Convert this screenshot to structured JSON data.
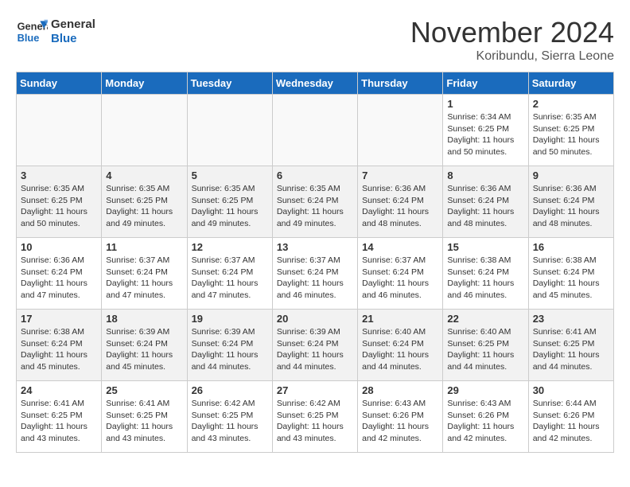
{
  "logo": {
    "general": "General",
    "blue": "Blue"
  },
  "header": {
    "title": "November 2024",
    "location": "Koribundu, Sierra Leone"
  },
  "weekdays": [
    "Sunday",
    "Monday",
    "Tuesday",
    "Wednesday",
    "Thursday",
    "Friday",
    "Saturday"
  ],
  "weeks": [
    [
      {
        "day": "",
        "info": ""
      },
      {
        "day": "",
        "info": ""
      },
      {
        "day": "",
        "info": ""
      },
      {
        "day": "",
        "info": ""
      },
      {
        "day": "",
        "info": ""
      },
      {
        "day": "1",
        "info": "Sunrise: 6:34 AM\nSunset: 6:25 PM\nDaylight: 11 hours and 50 minutes."
      },
      {
        "day": "2",
        "info": "Sunrise: 6:35 AM\nSunset: 6:25 PM\nDaylight: 11 hours and 50 minutes."
      }
    ],
    [
      {
        "day": "3",
        "info": "Sunrise: 6:35 AM\nSunset: 6:25 PM\nDaylight: 11 hours and 50 minutes."
      },
      {
        "day": "4",
        "info": "Sunrise: 6:35 AM\nSunset: 6:25 PM\nDaylight: 11 hours and 49 minutes."
      },
      {
        "day": "5",
        "info": "Sunrise: 6:35 AM\nSunset: 6:25 PM\nDaylight: 11 hours and 49 minutes."
      },
      {
        "day": "6",
        "info": "Sunrise: 6:35 AM\nSunset: 6:24 PM\nDaylight: 11 hours and 49 minutes."
      },
      {
        "day": "7",
        "info": "Sunrise: 6:36 AM\nSunset: 6:24 PM\nDaylight: 11 hours and 48 minutes."
      },
      {
        "day": "8",
        "info": "Sunrise: 6:36 AM\nSunset: 6:24 PM\nDaylight: 11 hours and 48 minutes."
      },
      {
        "day": "9",
        "info": "Sunrise: 6:36 AM\nSunset: 6:24 PM\nDaylight: 11 hours and 48 minutes."
      }
    ],
    [
      {
        "day": "10",
        "info": "Sunrise: 6:36 AM\nSunset: 6:24 PM\nDaylight: 11 hours and 47 minutes."
      },
      {
        "day": "11",
        "info": "Sunrise: 6:37 AM\nSunset: 6:24 PM\nDaylight: 11 hours and 47 minutes."
      },
      {
        "day": "12",
        "info": "Sunrise: 6:37 AM\nSunset: 6:24 PM\nDaylight: 11 hours and 47 minutes."
      },
      {
        "day": "13",
        "info": "Sunrise: 6:37 AM\nSunset: 6:24 PM\nDaylight: 11 hours and 46 minutes."
      },
      {
        "day": "14",
        "info": "Sunrise: 6:37 AM\nSunset: 6:24 PM\nDaylight: 11 hours and 46 minutes."
      },
      {
        "day": "15",
        "info": "Sunrise: 6:38 AM\nSunset: 6:24 PM\nDaylight: 11 hours and 46 minutes."
      },
      {
        "day": "16",
        "info": "Sunrise: 6:38 AM\nSunset: 6:24 PM\nDaylight: 11 hours and 45 minutes."
      }
    ],
    [
      {
        "day": "17",
        "info": "Sunrise: 6:38 AM\nSunset: 6:24 PM\nDaylight: 11 hours and 45 minutes."
      },
      {
        "day": "18",
        "info": "Sunrise: 6:39 AM\nSunset: 6:24 PM\nDaylight: 11 hours and 45 minutes."
      },
      {
        "day": "19",
        "info": "Sunrise: 6:39 AM\nSunset: 6:24 PM\nDaylight: 11 hours and 44 minutes."
      },
      {
        "day": "20",
        "info": "Sunrise: 6:39 AM\nSunset: 6:24 PM\nDaylight: 11 hours and 44 minutes."
      },
      {
        "day": "21",
        "info": "Sunrise: 6:40 AM\nSunset: 6:24 PM\nDaylight: 11 hours and 44 minutes."
      },
      {
        "day": "22",
        "info": "Sunrise: 6:40 AM\nSunset: 6:25 PM\nDaylight: 11 hours and 44 minutes."
      },
      {
        "day": "23",
        "info": "Sunrise: 6:41 AM\nSunset: 6:25 PM\nDaylight: 11 hours and 44 minutes."
      }
    ],
    [
      {
        "day": "24",
        "info": "Sunrise: 6:41 AM\nSunset: 6:25 PM\nDaylight: 11 hours and 43 minutes."
      },
      {
        "day": "25",
        "info": "Sunrise: 6:41 AM\nSunset: 6:25 PM\nDaylight: 11 hours and 43 minutes."
      },
      {
        "day": "26",
        "info": "Sunrise: 6:42 AM\nSunset: 6:25 PM\nDaylight: 11 hours and 43 minutes."
      },
      {
        "day": "27",
        "info": "Sunrise: 6:42 AM\nSunset: 6:25 PM\nDaylight: 11 hours and 43 minutes."
      },
      {
        "day": "28",
        "info": "Sunrise: 6:43 AM\nSunset: 6:26 PM\nDaylight: 11 hours and 42 minutes."
      },
      {
        "day": "29",
        "info": "Sunrise: 6:43 AM\nSunset: 6:26 PM\nDaylight: 11 hours and 42 minutes."
      },
      {
        "day": "30",
        "info": "Sunrise: 6:44 AM\nSunset: 6:26 PM\nDaylight: 11 hours and 42 minutes."
      }
    ]
  ]
}
